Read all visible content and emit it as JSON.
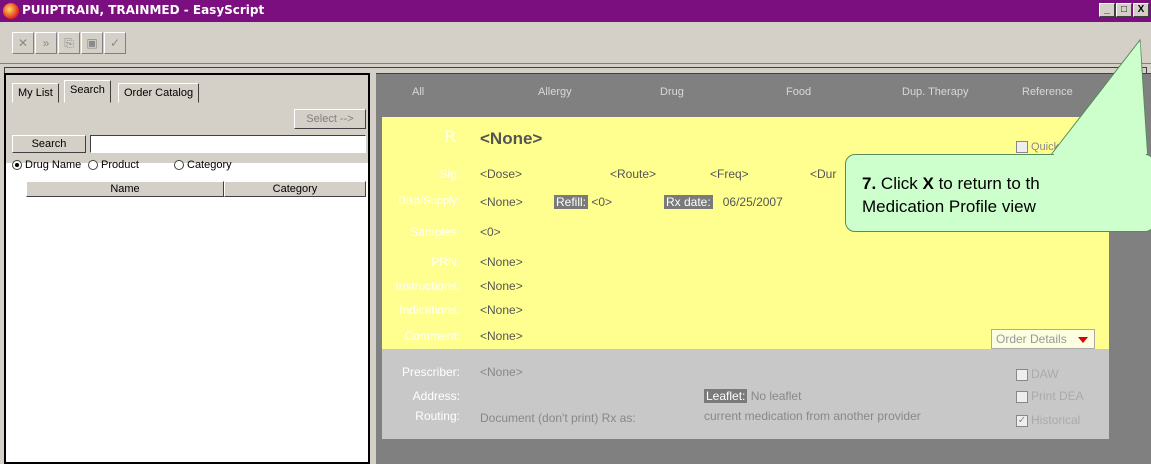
{
  "window": {
    "title": "PUIIPTRAIN, TRAINMED - EasyScript",
    "controls": [
      "_",
      "□",
      "X"
    ]
  },
  "toolbar": {
    "buttons": [
      {
        "icon": "cancel-x-icon",
        "glyph": "✕"
      },
      {
        "icon": "double-arrow-icon",
        "glyph": "»"
      },
      {
        "icon": "copy-icon",
        "glyph": "⎘"
      },
      {
        "icon": "pill-bottle-icon",
        "glyph": "▣"
      },
      {
        "icon": "sign-check-icon",
        "glyph": "✓"
      }
    ]
  },
  "left_panel": {
    "tabs": [
      "My List",
      "Search",
      "Order Catalog"
    ],
    "active_tab": "Search",
    "select_button": "Select -->",
    "search_button": "Search",
    "search_value": "",
    "radio_options": [
      {
        "label": "Drug Name",
        "selected": true
      },
      {
        "label": "Product",
        "selected": false
      },
      {
        "label": "Category",
        "selected": false
      }
    ],
    "columns": [
      "Name",
      "Category"
    ]
  },
  "right_panel": {
    "tabs": [
      "All",
      "Allergy",
      "Drug",
      "Food",
      "Dup. Therapy",
      "Reference"
    ],
    "rx_label": "R",
    "rx_value": "<None>",
    "quick_label": "Quick",
    "sig_label": "Sig:",
    "sig_dose": "<Dose>",
    "sig_route": "<Route>",
    "sig_freq": "<Freq>",
    "sig_dur": "<Dur",
    "disp_label": "Disp/Supply:",
    "disp_value": "<None>",
    "refill_label": "Refill:",
    "refill_value": "<0>",
    "rxdate_label": "Rx date:",
    "rxdate_value": "06/25/2007",
    "samples_label": "Samples:",
    "samples_value": "<0>",
    "prn_label": "PRN:",
    "prn_value": "<None>",
    "instructions_label": "Instructions:",
    "instructions_value": "<None>",
    "indications_label": "Indications:",
    "indications_value": "<None>",
    "comment_label": "Comment:",
    "comment_value": "<None>",
    "order_details": "Order Details",
    "prescriber_label": "Prescriber:",
    "prescriber_value": "<None>",
    "address_label": "Address:",
    "routing_label": "Routing:",
    "routing_value": "Document (don't print) Rx as:",
    "leaflet_label": "Leaflet:",
    "leaflet_value": "No leaflet",
    "routing_detail": "current medication from another provider",
    "checks": [
      {
        "label": "DAW",
        "checked": false
      },
      {
        "label": "Print DEA",
        "checked": false
      },
      {
        "label": "Historical",
        "checked": true
      }
    ]
  },
  "callout": {
    "step": "7.",
    "text1": "Click",
    "key": "X",
    "text2": "to return to th",
    "line2": "Medication Profile view"
  }
}
